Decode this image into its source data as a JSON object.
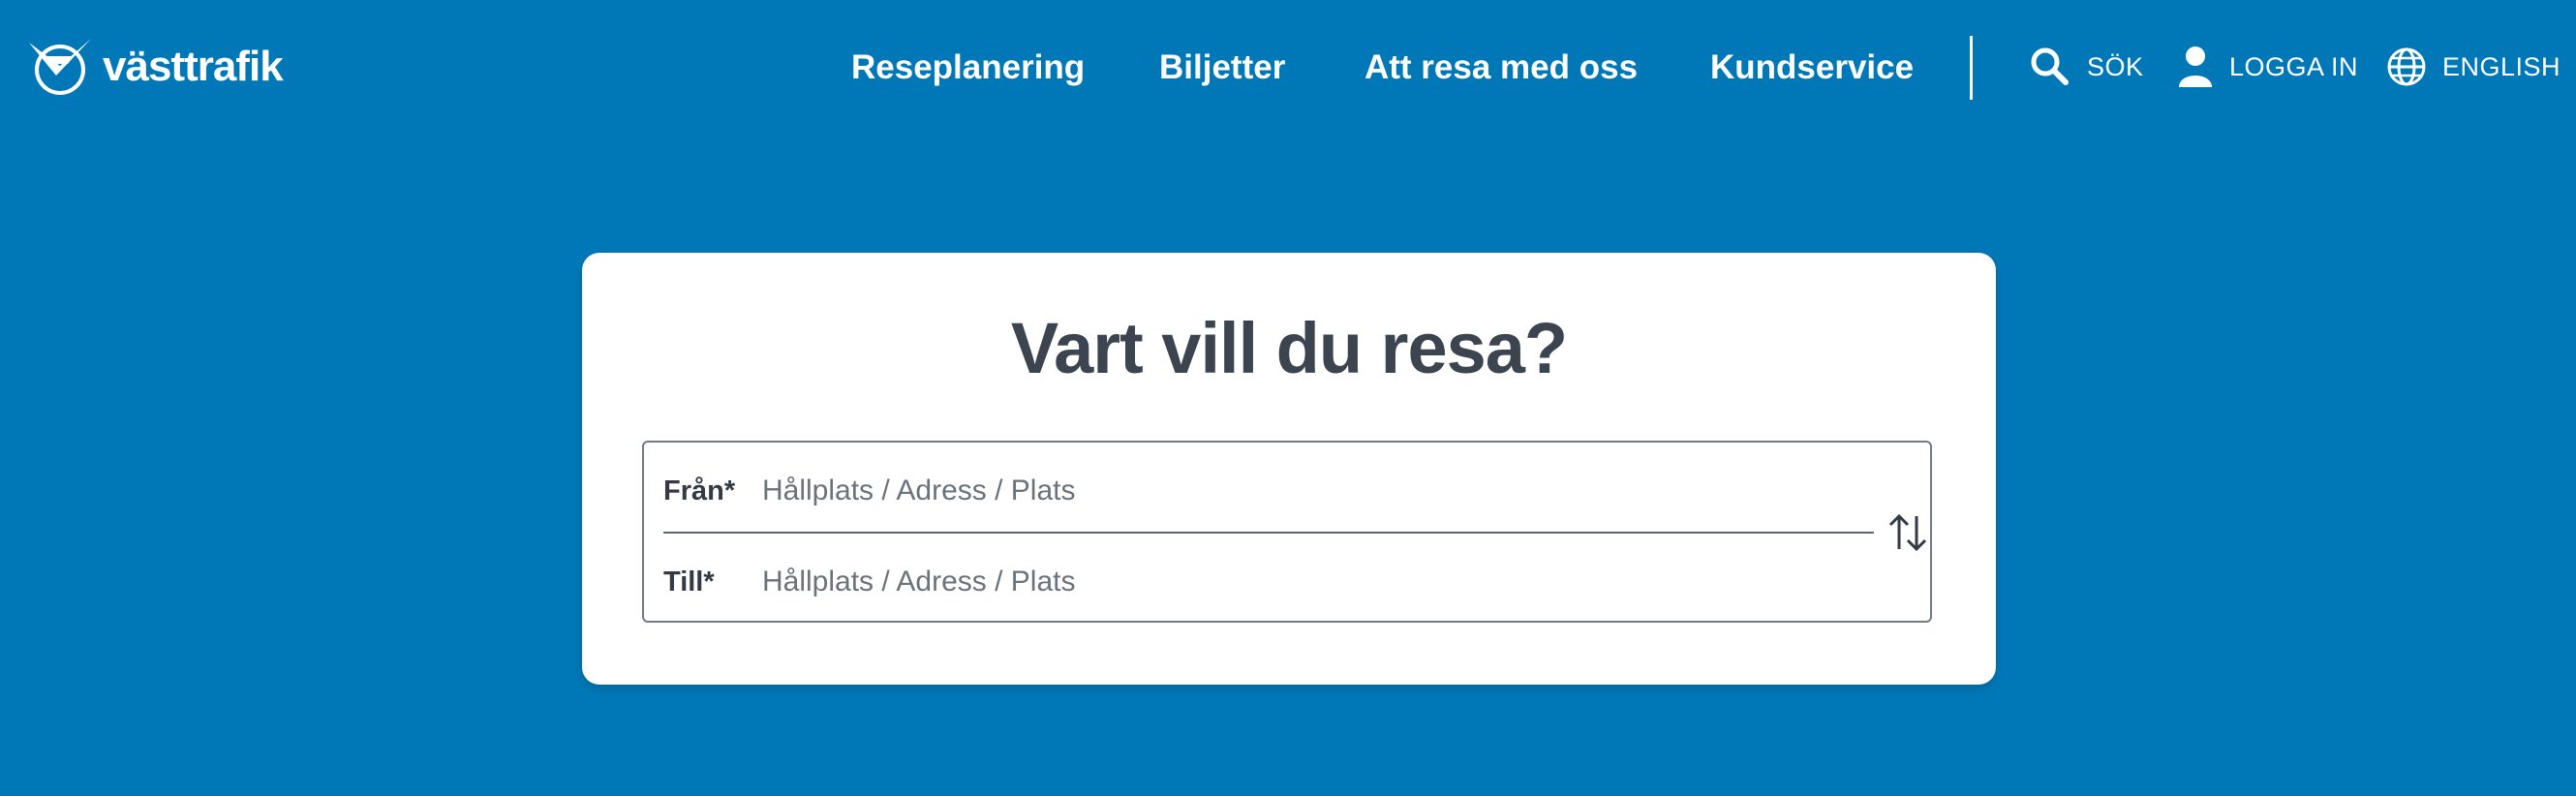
{
  "header": {
    "logo_text": "västtrafik",
    "nav": [
      {
        "label": "Reseplanering"
      },
      {
        "label": "Biljetter"
      },
      {
        "label": "Att resa med oss"
      },
      {
        "label": "Kundservice"
      }
    ],
    "search_label": "SÖK",
    "login_label": "LOGGA IN",
    "language_label": "ENGLISH"
  },
  "planner": {
    "title": "Vart vill du resa?",
    "from_label": "Från*",
    "from_placeholder": "Hållplats / Adress / Plats",
    "from_value": "",
    "to_label": "Till*",
    "to_placeholder": "Hållplats / Adress / Plats",
    "to_value": ""
  },
  "colors": {
    "background": "#0078b7",
    "card": "#ffffff",
    "title_text": "#3c4450"
  },
  "icons": [
    "vasttrafik-logo-icon",
    "search-icon",
    "user-icon",
    "globe-icon",
    "swap-arrows-icon"
  ]
}
